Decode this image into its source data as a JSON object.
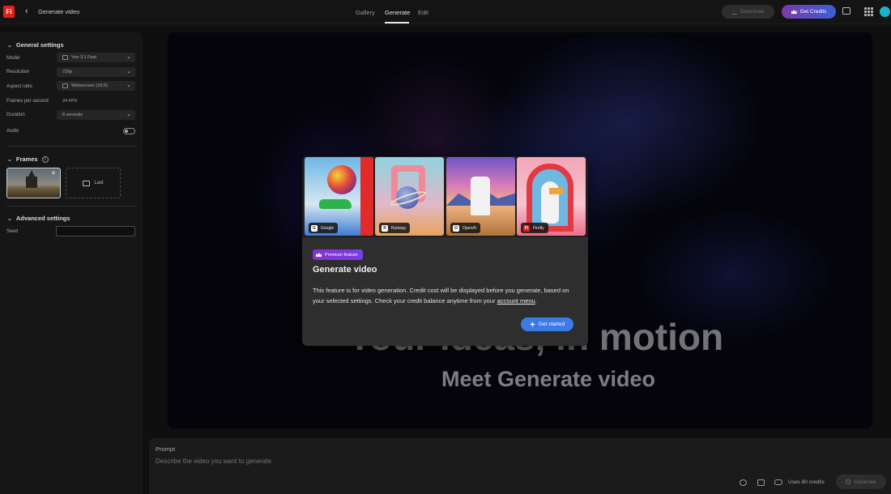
{
  "header": {
    "logo_text": "Fi",
    "back_glyph": "‹",
    "title": "Generate video",
    "tabs": [
      {
        "label": "Gallery",
        "active": false
      },
      {
        "label": "Generate",
        "active": true
      },
      {
        "label": "Edit",
        "active": false
      }
    ],
    "download_label": "Download",
    "get_credits_label": "Get Credits",
    "icons": [
      "feedback-icon",
      "apps-grid-icon",
      "avatar"
    ]
  },
  "sidebar": {
    "general_title": "General settings",
    "model_label": "Model",
    "model_value": "Veo 3.1 Fast",
    "resolution_label": "Resolution",
    "resolution_value": "720p",
    "aspect_label": "Aspect ratio",
    "aspect_value": "Widescreen (16:9)",
    "fps_label": "Frames per second",
    "fps_value": "24 FPS",
    "duration_label": "Duration",
    "duration_value": "8 seconds",
    "audio_label": "Audio",
    "audio_enabled": false,
    "frames_title": "Frames",
    "last_frame_label": "Last",
    "advanced_title": "Advanced settings",
    "seed_label": "Seed",
    "seed_value": ""
  },
  "preview": {
    "headline": "Your ideas, in motion",
    "subheadline": "Meet Generate video"
  },
  "modal": {
    "providers": [
      "Google",
      "Runway",
      "OpenAI",
      "Firefly"
    ],
    "provider_icons": [
      "G",
      "R",
      "O",
      "Fi"
    ],
    "badge": "Premium feature",
    "title": "Generate video",
    "body": "This feature is for video generation. Credit cost will be displayed before you generate, based on your selected settings. Check your credit balance anytime from your ",
    "body_link": "account menu",
    "body_end": ".",
    "cta": "Get started"
  },
  "prompt": {
    "label": "Prompt",
    "placeholder": "Describe the video you want to generate",
    "credits_text": "Uses 80 credits",
    "generate_label": "Generate"
  },
  "colors": {
    "accent": "#3b7be8",
    "brand": "#e0201b",
    "premium": "#8c2fd0",
    "avatar": "#13b5c8"
  }
}
